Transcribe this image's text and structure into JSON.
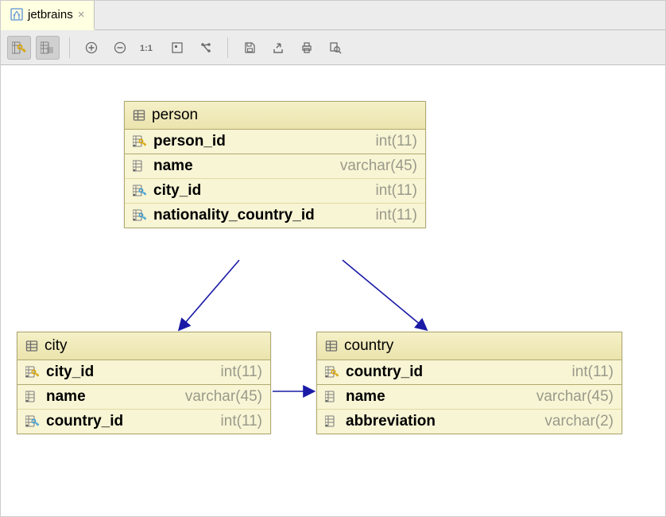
{
  "tab": {
    "label": "jetbrains"
  },
  "toolbar": {
    "key_columns": "Key columns",
    "all_columns": "All columns",
    "zoom_in": "Zoom in",
    "zoom_out": "Zoom out",
    "actual_size": "1:1",
    "fit_content": "Fit content",
    "layout": "Layout",
    "save": "Save",
    "export": "Export",
    "print": "Print",
    "preview": "Preview"
  },
  "tables": {
    "person": {
      "name": "person",
      "pk": [
        {
          "name": "person_id",
          "type": "int(11)"
        }
      ],
      "cols": [
        {
          "name": "name",
          "type": "varchar(45)",
          "fk": false
        },
        {
          "name": "city_id",
          "type": "int(11)",
          "fk": true
        },
        {
          "name": "nationality_country_id",
          "type": "int(11)",
          "fk": true
        }
      ]
    },
    "city": {
      "name": "city",
      "pk": [
        {
          "name": "city_id",
          "type": "int(11)"
        }
      ],
      "cols": [
        {
          "name": "name",
          "type": "varchar(45)",
          "fk": false
        },
        {
          "name": "country_id",
          "type": "int(11)",
          "fk": true
        }
      ]
    },
    "country": {
      "name": "country",
      "pk": [
        {
          "name": "country_id",
          "type": "int(11)"
        }
      ],
      "cols": [
        {
          "name": "name",
          "type": "varchar(45)",
          "fk": false
        },
        {
          "name": "abbreviation",
          "type": "varchar(2)",
          "fk": false
        }
      ]
    }
  },
  "relations": [
    {
      "from": "person",
      "to": "city"
    },
    {
      "from": "person",
      "to": "country"
    },
    {
      "from": "city",
      "to": "country"
    }
  ]
}
